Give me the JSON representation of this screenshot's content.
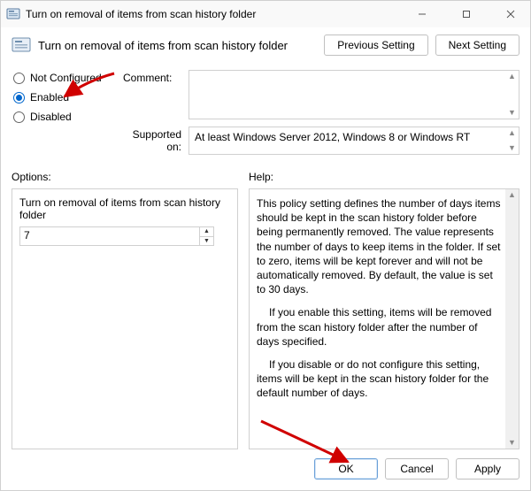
{
  "window": {
    "title": "Turn on removal of items from scan history folder"
  },
  "header": {
    "heading": "Turn on removal of items from scan history folder",
    "previous_label": "Previous Setting",
    "next_label": "Next Setting"
  },
  "radios": {
    "not_configured": "Not Configured",
    "enabled": "Enabled",
    "disabled": "Disabled",
    "selected": "enabled"
  },
  "comment": {
    "label": "Comment:",
    "value": ""
  },
  "supported": {
    "label": "Supported on:",
    "value": "At least Windows Server 2012, Windows 8 or Windows RT"
  },
  "mid": {
    "options_label": "Options:",
    "help_label": "Help:"
  },
  "options": {
    "title": "Turn on removal of items from scan history folder",
    "value": "7"
  },
  "help": {
    "p1": "This policy setting defines the number of days items should be kept in the scan history folder before being permanently removed. The value represents the number of days to keep items in the folder. If set to zero, items will be kept forever and will not be automatically removed. By default, the value is set to 30 days.",
    "p2": "If you enable this setting, items will be removed from the scan history folder after the number of days specified.",
    "p3": "If you disable or do not configure this setting, items will be kept in the scan history folder for the default number of days."
  },
  "footer": {
    "ok": "OK",
    "cancel": "Cancel",
    "apply": "Apply"
  },
  "colors": {
    "accent": "#0066cc",
    "arrow": "#d00000"
  }
}
